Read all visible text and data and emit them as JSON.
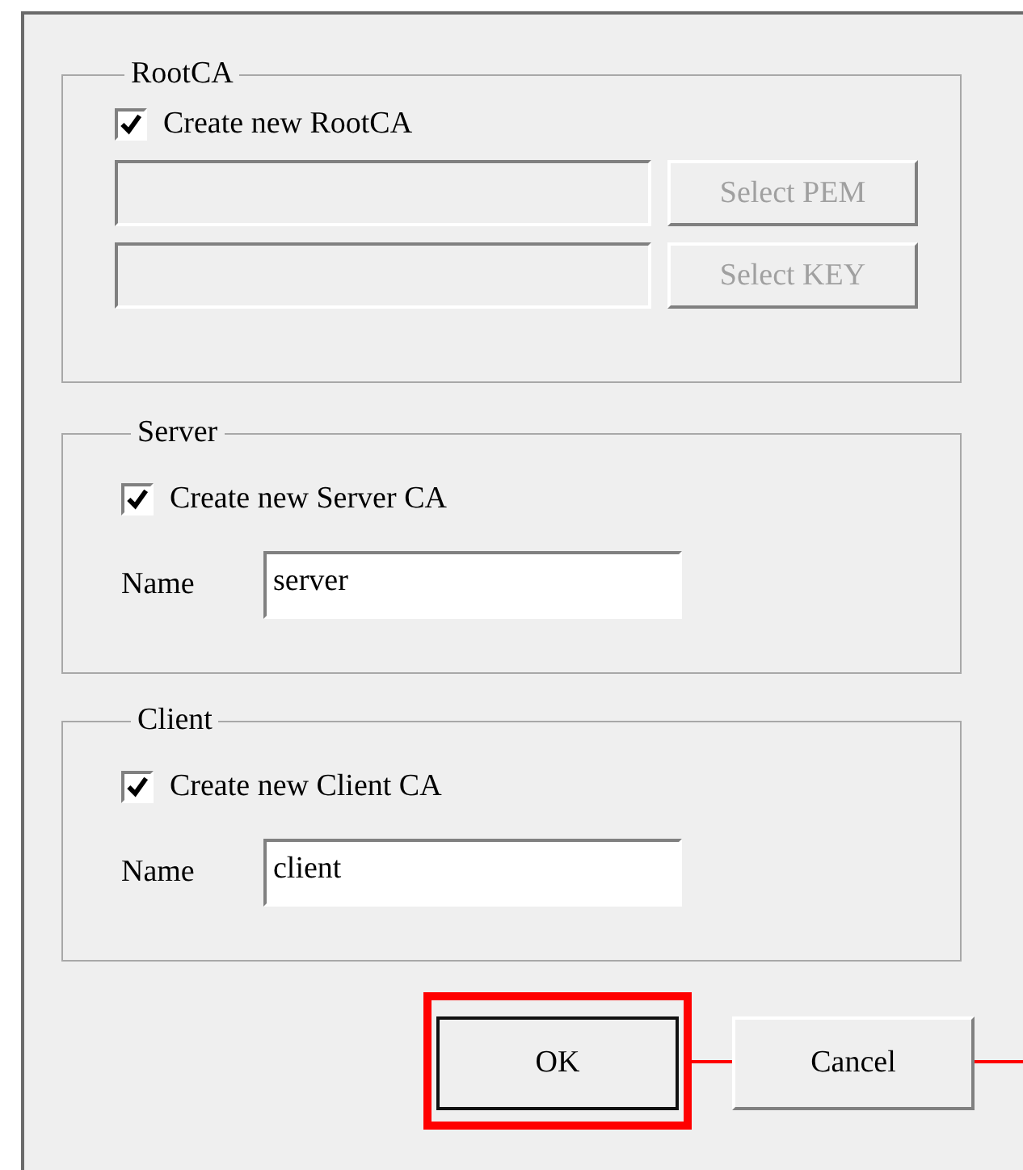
{
  "groups": [
    {
      "title": "RootCA",
      "kind": "files",
      "checkbox": {
        "label": "Create new RootCA",
        "checked": true
      },
      "rows": [
        {
          "value": "",
          "button": "Select PEM",
          "disabled": true
        },
        {
          "value": "",
          "button": "Select KEY",
          "disabled": true
        }
      ]
    },
    {
      "title": "Server",
      "kind": "name",
      "checkbox": {
        "label": "Create new Server CA",
        "checked": true
      },
      "name_label": "Name",
      "value": "server"
    },
    {
      "title": "Client",
      "kind": "name",
      "checkbox": {
        "label": "Create new Client CA",
        "checked": true
      },
      "name_label": "Name",
      "value": "client"
    }
  ],
  "buttons": [
    {
      "label": "OK",
      "highlighted": true
    },
    {
      "label": "Cancel",
      "highlighted": false
    }
  ]
}
